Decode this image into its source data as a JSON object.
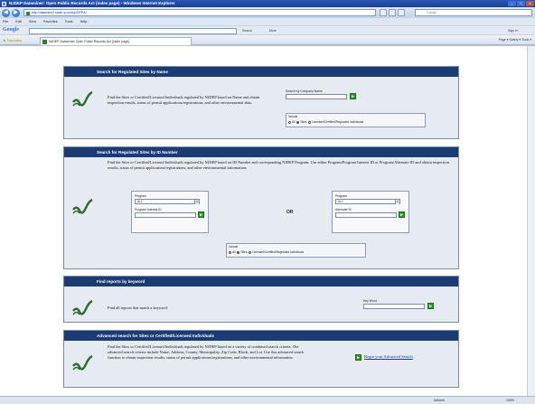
{
  "window": {
    "title": "NJDEP Dataminer: Open Public Records Act (index page) - Windows Internet Explorer"
  },
  "address_bar": {
    "url": "http://datamine2.state.nj.us/dep/OPRA/",
    "search_placeholder": "Google"
  },
  "menu": {
    "items": [
      "File",
      "Edit",
      "View",
      "Favorites",
      "Tools",
      "Help"
    ]
  },
  "google_toolbar": {
    "logo": "Google",
    "search_button": "Search",
    "more_button": "More",
    "sign_in": "Sign In"
  },
  "favorites_bar": {
    "favorites_label": "Favorites",
    "tab_title": "NJDEP-Dataminer Open Public Records Act (index page)",
    "commands": "Page ▾  Safety ▾  Tools ▾"
  },
  "section_name": {
    "header": "Search for Regulated Sites by Name",
    "description": "Find the Sites or Certified/Licensed Individuals regulated by NJDEP based on Name and obtain inspection results, status of permit applications/registrations, and other environmental data.",
    "company_label": "Search by Company Name",
    "include_label": "Include",
    "options": [
      "All",
      "Sites",
      "Licensed/Certified/Regulated Individuals"
    ]
  },
  "section_id": {
    "header": "Search for Regulated Sites by ID Number",
    "description": "Find the Sites or Certified/Licensed Individuals regulated by NJDEP based on ID Number and corresponding NJDEP Program. Use either Program/Program Interest ID or Program/Alternate ID and obtain inspection results, status of permit applications/registrations, and other environmental information.",
    "left": {
      "program_label": "Program",
      "program_value": "ALL",
      "id_label": "Program Interest ID"
    },
    "or_label": "OR",
    "right": {
      "program_label": "Program",
      "program_value": "ALL",
      "id_label": "Alternate ID"
    },
    "include_label": "Include",
    "options": [
      "All",
      "Sites",
      "Licensed/Certified/Regulated Individuals"
    ]
  },
  "section_keyword": {
    "header": "Find reports by keyword",
    "description": "Find all reports that match a keyword.",
    "keyword_label": "Key Word"
  },
  "section_advanced": {
    "header": "Advanced search for Sites or Certified/Licensed Individuals",
    "description": "Find the Sites or Certified/Licensed Individuals regulated by NJDEP based on a variety of combined search criteria. The advanced search criteria include Name, Address, County, Municipality, Zip Code, Block, and Lot. Use this advanced search function to obtain inspection results, status of permit applications/registrations, and other environmental information.",
    "link": "Begin your Advanced Search"
  },
  "status_bar": {
    "zone": "Internet",
    "zoom": "100%"
  }
}
